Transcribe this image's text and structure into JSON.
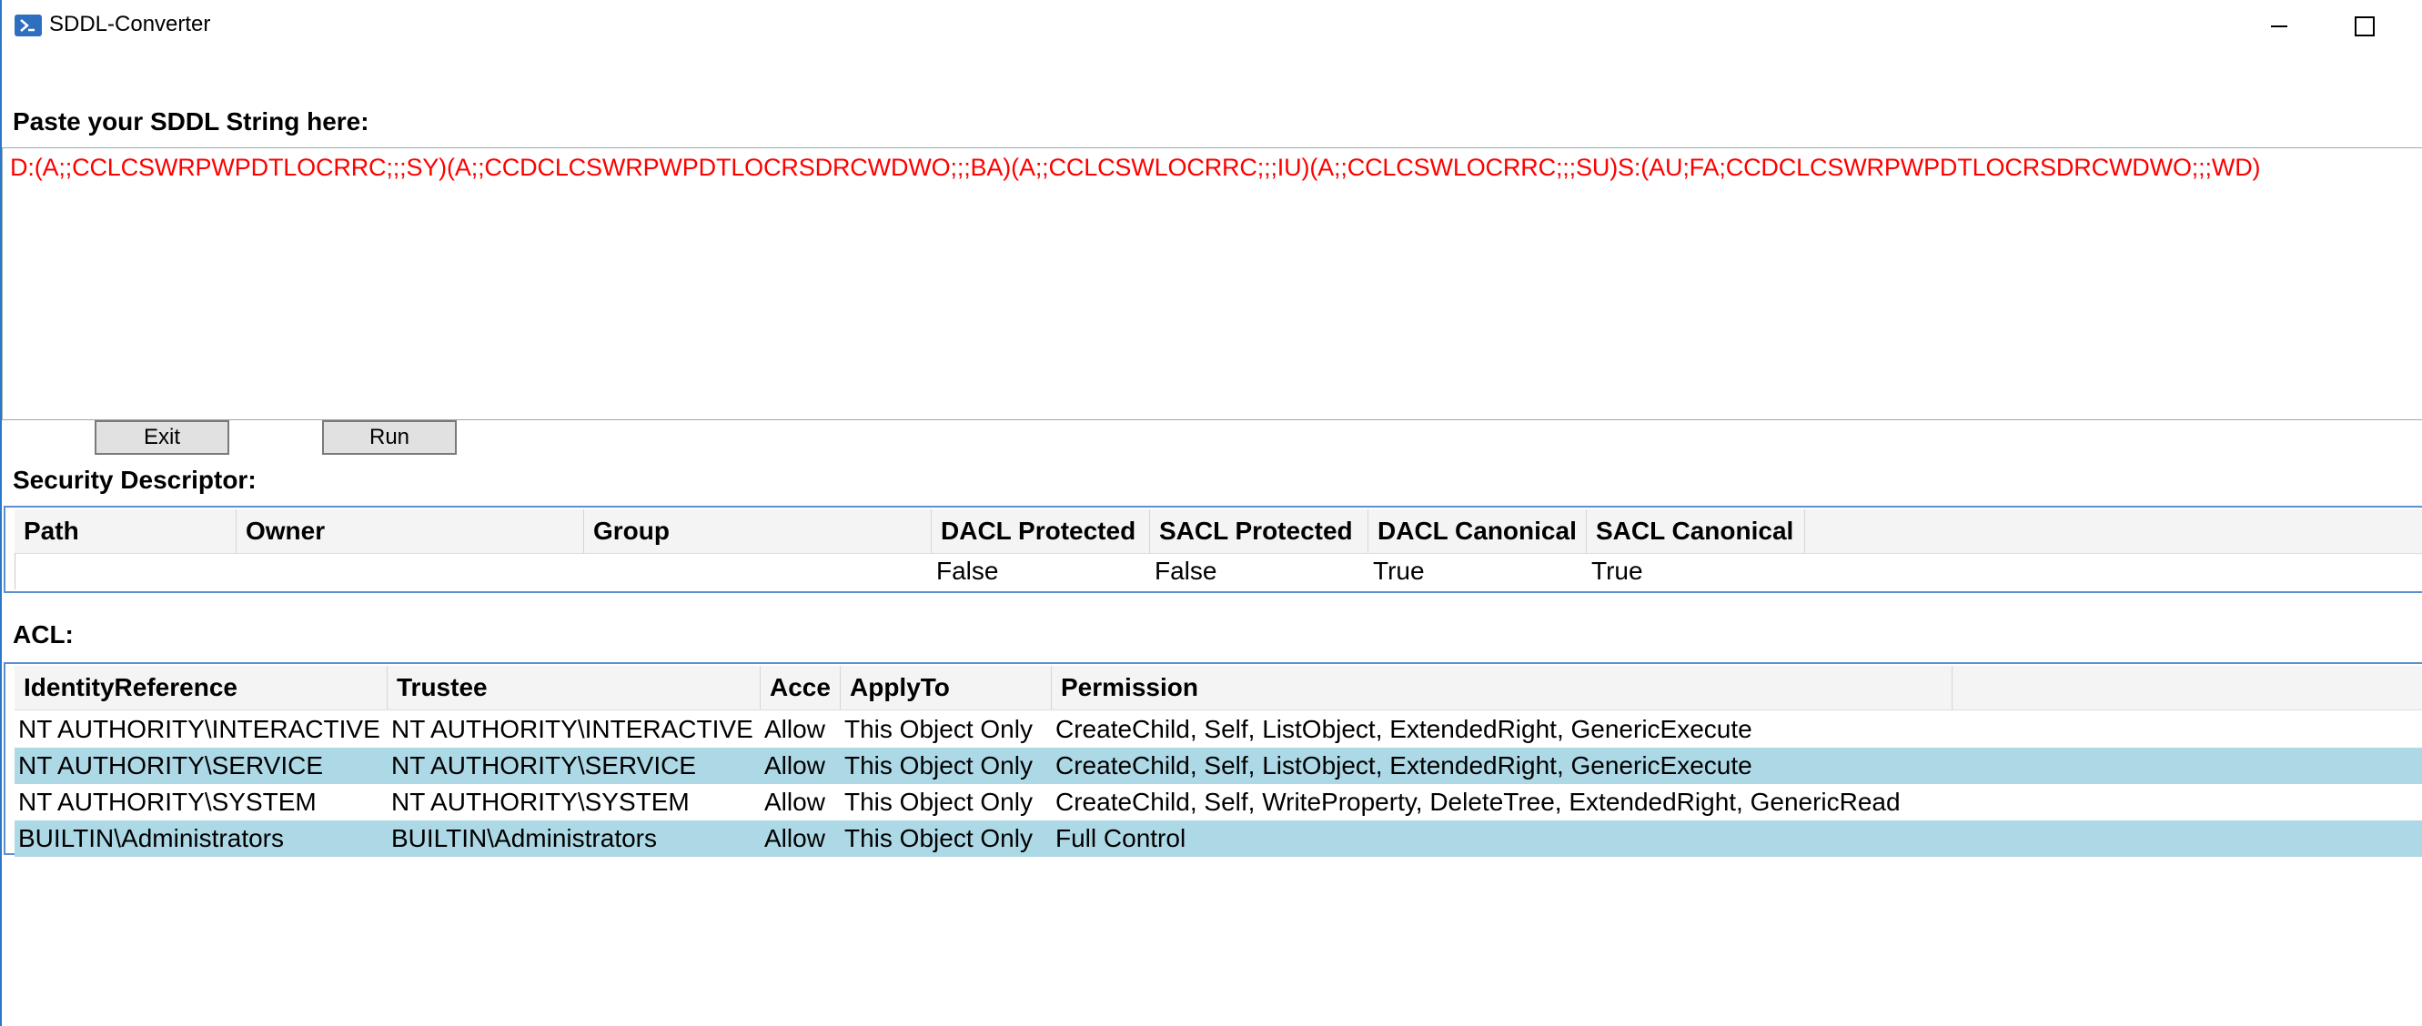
{
  "window": {
    "title": "SDDL-Converter",
    "icon": "powershell-icon",
    "controls": [
      "minimize-icon",
      "maximize-icon"
    ]
  },
  "sddl": {
    "label": "Paste your SDDL String here:",
    "value": "D:(A;;CCLCSWRPWPDTLOCRRC;;;SY)(A;;CCDCLCSWRPWPDTLOCRSDRCWDWO;;;BA)(A;;CCLCSWLOCRRC;;;IU)(A;;CCLCSWLOCRRC;;;SU)S:(AU;FA;CCDCLCSWRPWPDTLOCRSDRCWDWO;;;WD)",
    "text_color": "#ff0000"
  },
  "buttons": {
    "exit": "Exit",
    "run": "Run"
  },
  "security_descriptor": {
    "label": "Security Descriptor:",
    "columns": [
      "Path",
      "Owner",
      "Group",
      "DACL Protected",
      "SACL Protected",
      "DACL Canonical",
      "SACL Canonical"
    ],
    "row": [
      "",
      "",
      "",
      "False",
      "False",
      "True",
      "True"
    ]
  },
  "acl": {
    "label": "ACL:",
    "columns": [
      "IdentityReference",
      "Trustee",
      "Acce",
      "ApplyTo",
      "Permission"
    ],
    "rows": [
      [
        "NT AUTHORITY\\INTERACTIVE",
        "NT AUTHORITY\\INTERACTIVE",
        "Allow",
        "This Object Only",
        "CreateChild, Self, ListObject, ExtendedRight, GenericExecute"
      ],
      [
        "NT AUTHORITY\\SERVICE",
        "NT AUTHORITY\\SERVICE",
        "Allow",
        "This Object Only",
        "CreateChild, Self, ListObject, ExtendedRight, GenericExecute"
      ],
      [
        "NT AUTHORITY\\SYSTEM",
        "NT AUTHORITY\\SYSTEM",
        "Allow",
        "This Object Only",
        "CreateChild, Self, WriteProperty, DeleteTree, ExtendedRight, GenericRead"
      ],
      [
        "BUILTIN\\Administrators",
        "BUILTIN\\Administrators",
        "Allow",
        "This Object Only",
        "Full Control"
      ]
    ],
    "alt_row_color": "#add8e6"
  }
}
